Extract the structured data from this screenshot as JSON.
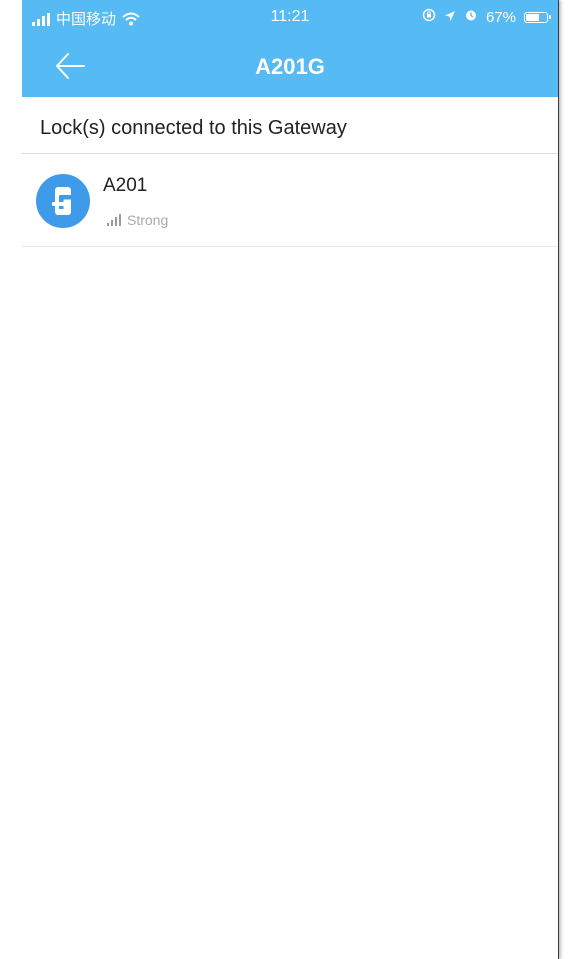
{
  "colors": {
    "header_bg": "#56baf5",
    "avatar_bg": "#3d9be9"
  },
  "statusbar": {
    "carrier": "中国移动",
    "time": "11:21",
    "battery_percent": "67%",
    "battery_level": 0.67,
    "icons": [
      "signal-icon",
      "wifi-icon",
      "rotation-lock-icon",
      "location-icon",
      "alarm-icon",
      "battery-icon"
    ]
  },
  "nav": {
    "back_icon": "back-arrow-icon",
    "title": "A201G"
  },
  "section": {
    "title": "Lock(s) connected to this Gateway"
  },
  "locks": [
    {
      "name": "A201",
      "signal": "Strong",
      "icon": "door-lock-icon"
    }
  ]
}
